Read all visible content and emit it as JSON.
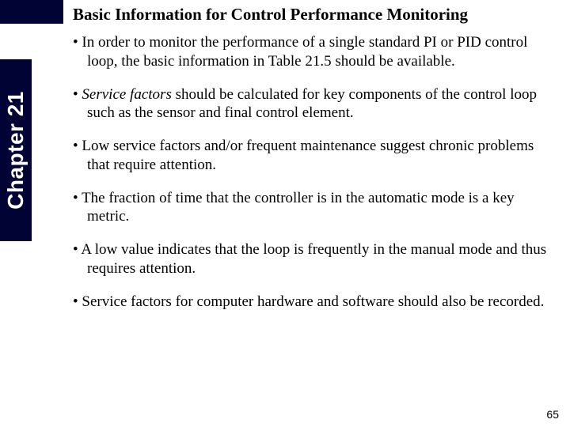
{
  "title": "Basic Information for Control Performance Monitoring",
  "chapter_label": "Chapter 21",
  "bullets": {
    "b1a": "In order to monitor the performance of a single standard PI or PID control loop, the basic information in Table 21.5 should be available.",
    "b2_emph": "Service factors",
    "b2_rest": " should be calculated for key components of the control loop such as the sensor and final control element.",
    "b3": "Low service factors and/or frequent maintenance suggest chronic problems that require attention.",
    "b4": "The fraction of time that the controller is in the automatic mode is a key metric.",
    "b5": "A low value indicates that the loop is frequently in the manual mode and thus requires attention.",
    "b6": "Service factors for computer hardware and software should also be recorded."
  },
  "page_number": "65"
}
